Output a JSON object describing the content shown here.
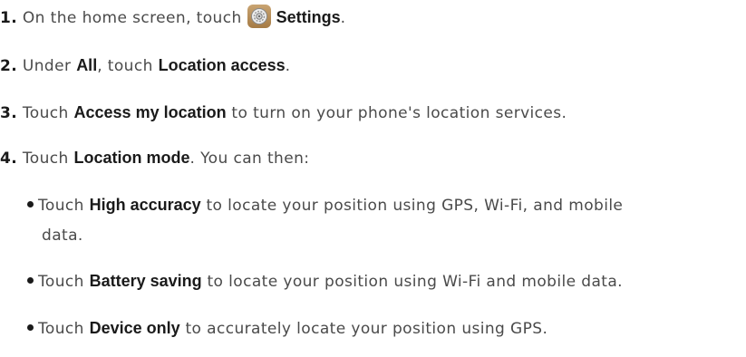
{
  "steps": [
    {
      "number": "1.",
      "text_before": "On the home screen, touch",
      "icon": "settings-gear-icon",
      "bold": "Settings",
      "text_after": "."
    },
    {
      "number": "2.",
      "text_before": "Under",
      "bold1": "All",
      "text_mid": ", touch",
      "bold2": "Location access",
      "text_after": "."
    },
    {
      "number": "3.",
      "text_before": "Touch",
      "bold": "Access my location",
      "text_after": "to turn on your phone's location services."
    },
    {
      "number": "4.",
      "text_before": "Touch",
      "bold": "Location mode",
      "text_after": ". You can then:"
    }
  ],
  "options": [
    {
      "text_before": "Touch",
      "bold": "High accuracy",
      "text_after": "to locate your position using GPS, Wi-Fi, and mobile",
      "continuation": "data."
    },
    {
      "text_before": "Touch",
      "bold": "Battery saving",
      "text_after": "to locate your position using Wi-Fi and mobile data."
    },
    {
      "text_before": "Touch",
      "bold": "Device only",
      "text_after": "to accurately locate your position using GPS."
    }
  ]
}
